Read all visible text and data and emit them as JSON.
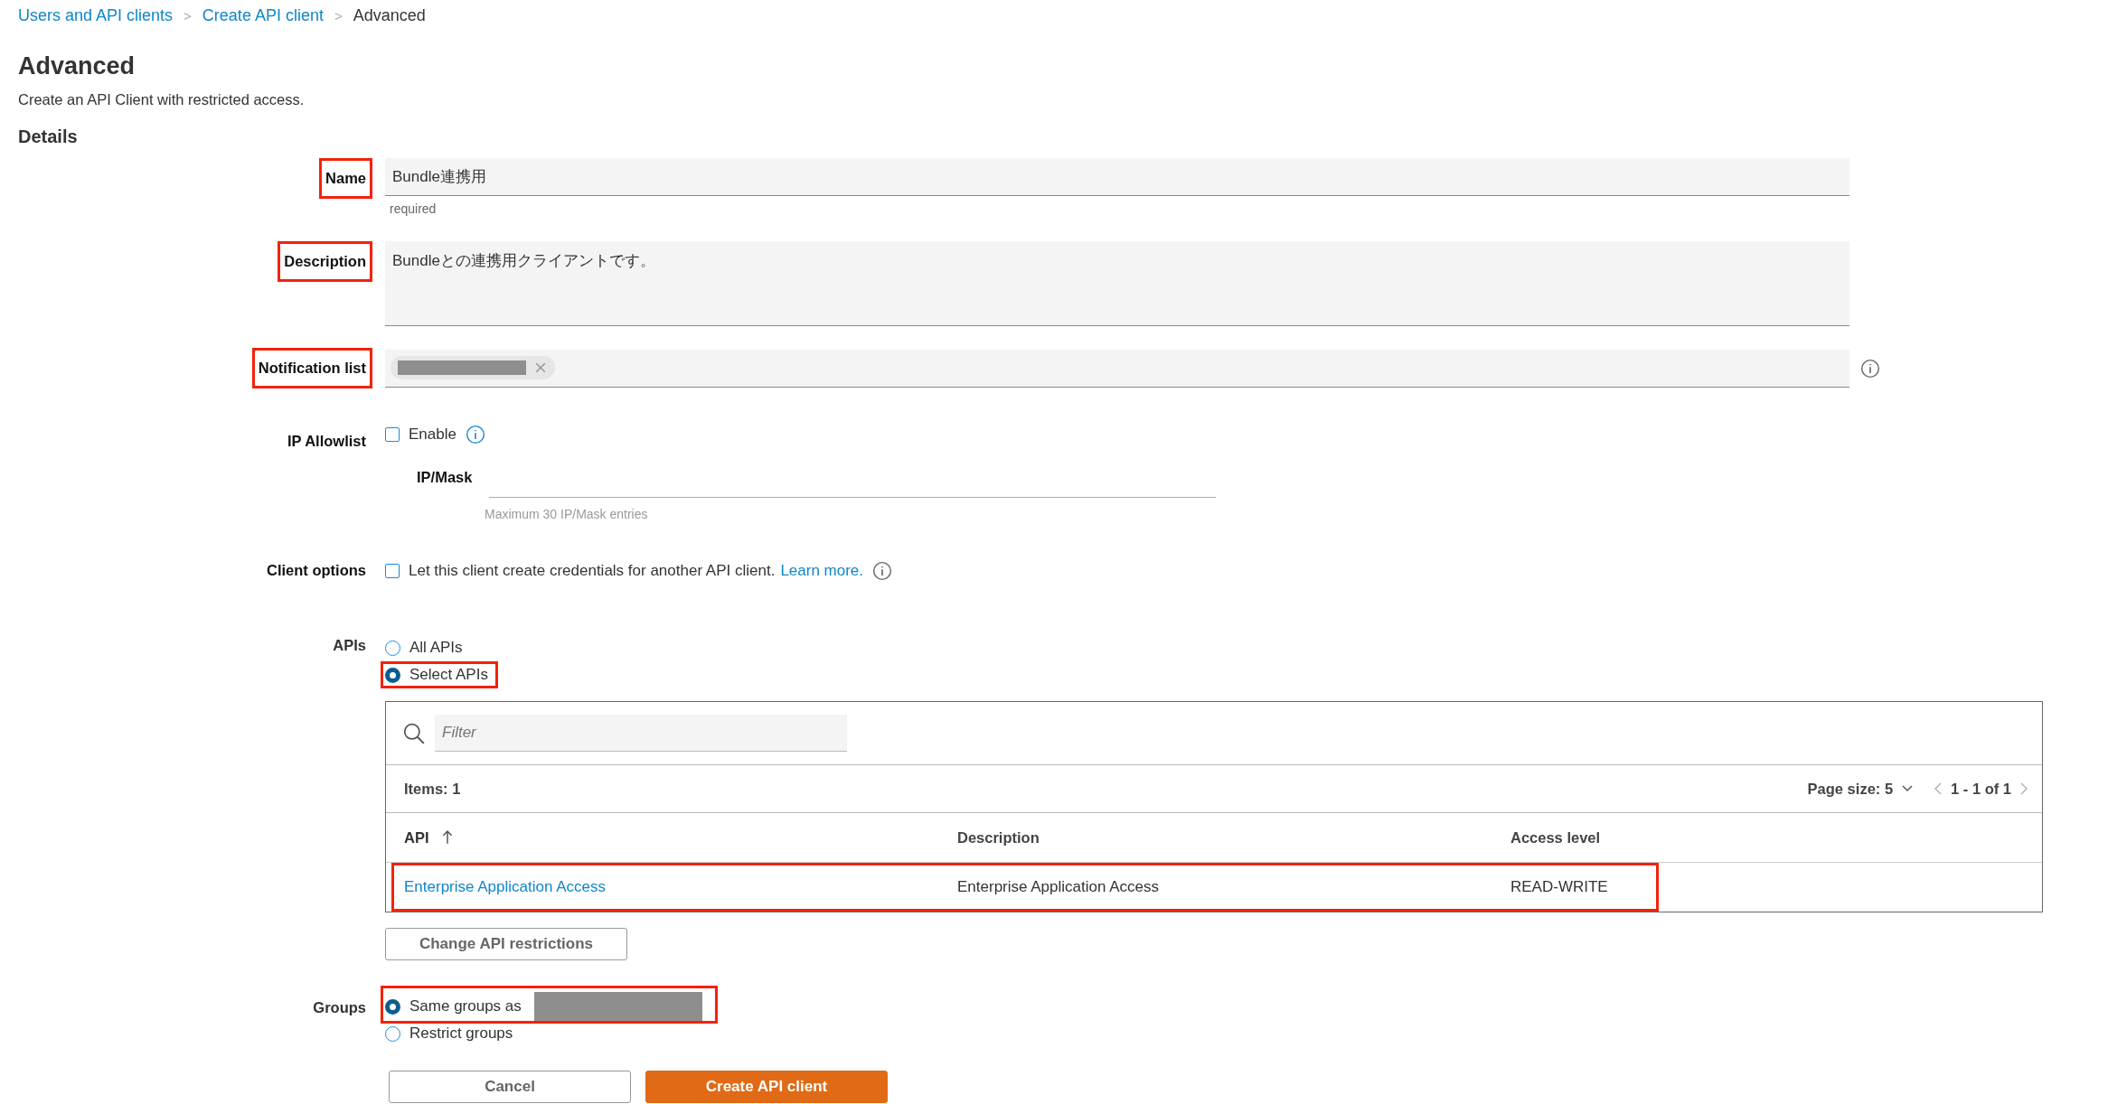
{
  "breadcrumb": [
    {
      "label": "Users and API clients",
      "kind": "link",
      "separator": ">"
    },
    {
      "label": "Create API client",
      "kind": "link",
      "separator": ">"
    },
    {
      "label": "Advanced",
      "kind": "current"
    }
  ],
  "title": "Advanced",
  "subtitle": "Create an API Client with restricted access.",
  "section": "Details",
  "name": {
    "label": "Name",
    "value": "Bundle連携用",
    "hint": "required",
    "highlighted": true
  },
  "description": {
    "label": "Description",
    "value": "Bundleとの連携用クライアントです。",
    "highlighted": true
  },
  "notification": {
    "label": "Notification list",
    "chip": {
      "redacted": true
    },
    "highlighted": true
  },
  "ip_allowlist": {
    "label": "IP Allowlist",
    "checkbox_label": "Enable",
    "checked": false,
    "ip_label": "IP/Mask",
    "hint": "Maximum 30 IP/Mask entries"
  },
  "client_options": {
    "label": "Client options",
    "checked": false,
    "text": "Let this client create credentials for another API client.",
    "link": "Learn more."
  },
  "apis": {
    "label": "APIs",
    "options": [
      {
        "label": "All APIs",
        "selected": false,
        "highlighted": false
      },
      {
        "label": "Select APIs",
        "selected": true,
        "highlighted": true
      }
    ]
  },
  "table": {
    "filter_placeholder": "Filter",
    "items": "Items: 1",
    "page_size": "Page size: 5",
    "range": "1 - 1 of 1",
    "columns": [
      {
        "label": "API",
        "sorted": true
      },
      {
        "label": "Description",
        "sorted": false
      },
      {
        "label": "Access level",
        "sorted": false
      }
    ],
    "rows": [
      {
        "cells": [
          "Enterprise Application Access",
          "Enterprise Application Access",
          "READ-WRITE"
        ],
        "highlighted": true
      }
    ]
  },
  "change_button": "Change API restrictions",
  "groups": {
    "label": "Groups",
    "options": [
      {
        "label": "Same groups as",
        "selected": true,
        "redacted": true,
        "highlighted": true
      },
      {
        "label": "Restrict groups",
        "selected": false,
        "redacted": false,
        "highlighted": false
      }
    ]
  },
  "buttons": [
    {
      "label": "Cancel",
      "kind": "secondary"
    },
    {
      "label": "Create API client",
      "kind": "primary"
    }
  ]
}
